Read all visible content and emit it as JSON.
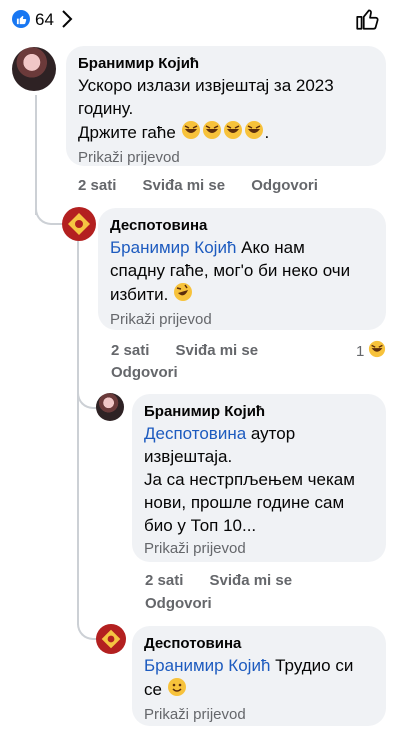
{
  "header": {
    "reaction_count": "64"
  },
  "comments": [
    {
      "author": "Бранимир Којић",
      "text_lines": [
        "Ускоро излази извјештај за 2023",
        "годину.",
        "Држите гаће"
      ],
      "translate": "Prikaži prijevod",
      "time": "2 sati",
      "like": "Sviđa mi se",
      "reply": "Odgovori"
    },
    {
      "author": "Деспотовина",
      "mention": "Бранимир Којић",
      "text_lines": [
        " Ако нам",
        "спадну гаће, мог'о би неко очи",
        "избити."
      ],
      "translate": "Prikaži prijevod",
      "time": "2 sati",
      "like": "Sviđa mi se",
      "reply": "Odgovori",
      "reaction_count": "1"
    },
    {
      "author": "Бранимир Којић",
      "mention": "Деспотовина",
      "text_lines": [
        " аутор",
        "извјештаја.",
        "Ја са нестрпљењем чекам",
        "нови, прошле године сам",
        "био у Топ 10..."
      ],
      "translate": "Prikaži prijevod",
      "time": "2 sati",
      "like": "Sviđa mi se",
      "reply": "Odgovori"
    },
    {
      "author": "Деспотовина",
      "mention": "Бранимир Којић",
      "text_lines": [
        " Трудио си",
        "се"
      ],
      "translate": "Prikaži prijevod"
    }
  ],
  "colors": {
    "accent": "#1877f2",
    "mention": "#1d5bbf",
    "meta": "#65676b",
    "bubble": "#f0f2f5"
  },
  "icons": [
    "like-icon",
    "chevron-right-icon",
    "thumbs-up-icon",
    "laughing-emoji-icon",
    "rofl-emoji-icon",
    "smile-emoji-icon",
    "crest-icon"
  ]
}
